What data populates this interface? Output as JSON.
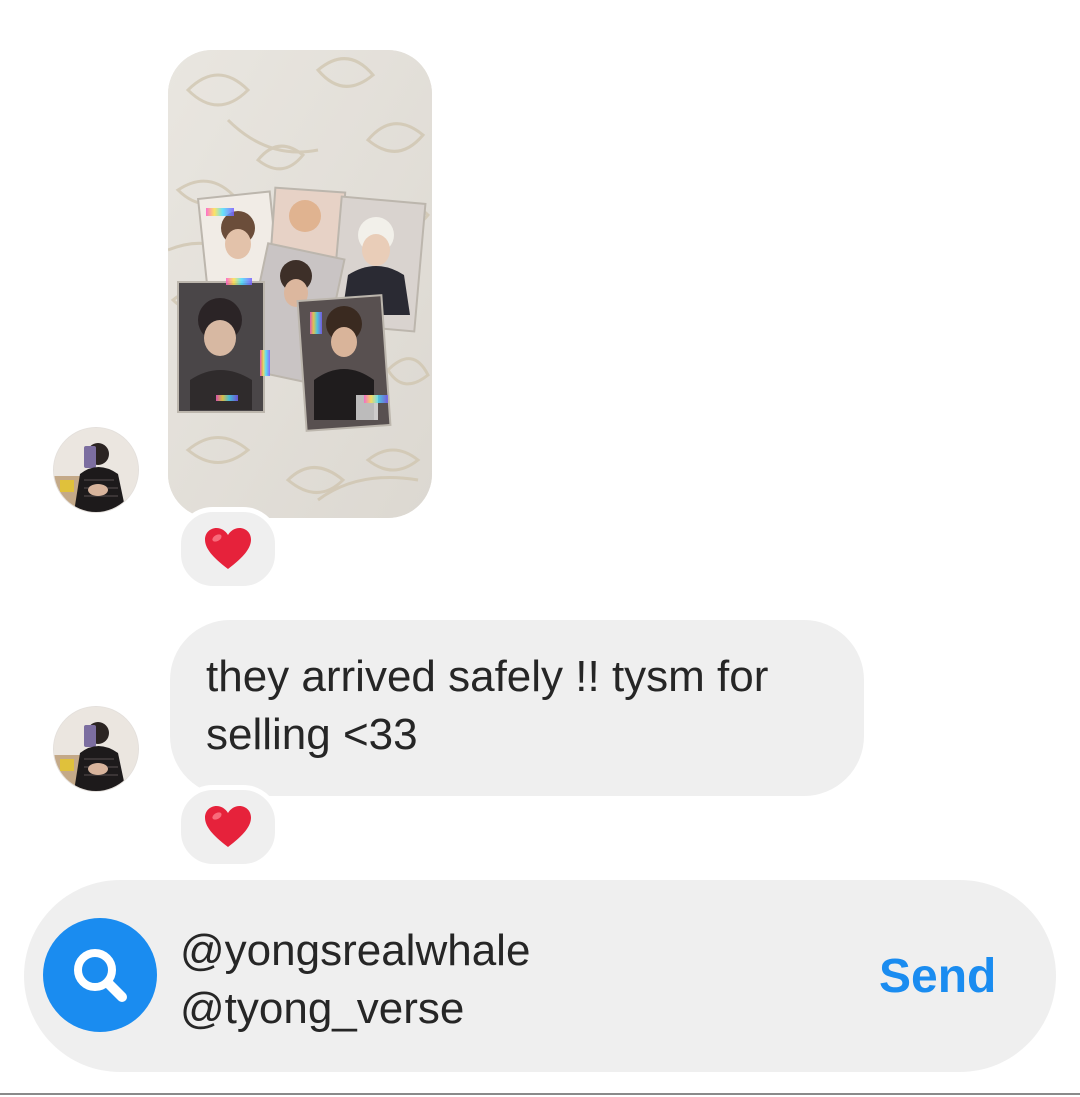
{
  "thread": {
    "messages": [
      {
        "type": "photo",
        "avatar_icon": "user-avatar",
        "reaction": "❤️",
        "reaction_icon": "heart-icon"
      },
      {
        "type": "text",
        "avatar_icon": "user-avatar",
        "text": "they arrived safely !! tysm for\nselling <33",
        "reaction": "❤️",
        "reaction_icon": "heart-icon"
      }
    ]
  },
  "composer": {
    "icon": "search-icon",
    "value": "@yongsrealwhale\n@tyong_verse",
    "send_label": "Send"
  },
  "colors": {
    "accent": "#1a8cf0",
    "bubble": "#efefef",
    "text": "#262626",
    "heart": "#e6223b"
  }
}
